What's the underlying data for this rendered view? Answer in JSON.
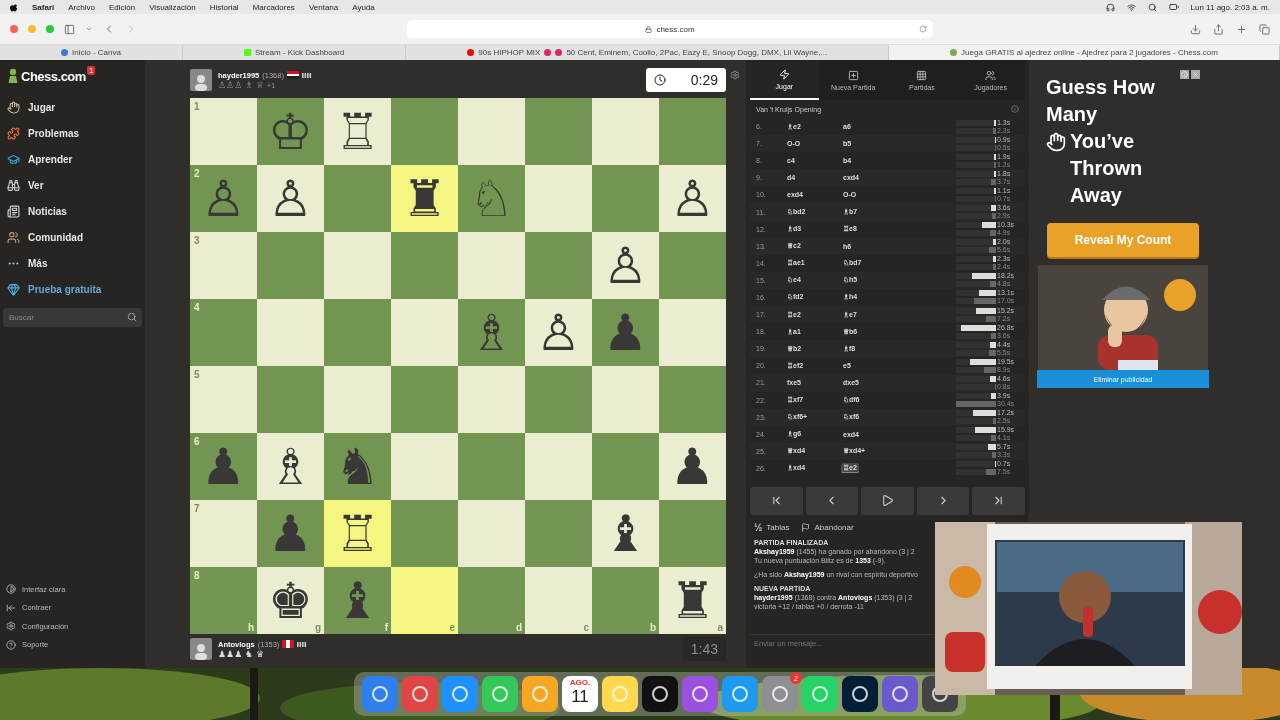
{
  "menubar": {
    "app": "Safari",
    "menus": [
      "Archivo",
      "Edición",
      "Visualización",
      "Historial",
      "Marcadores",
      "Ventana",
      "Ayuda"
    ],
    "clock": "Lun 11 ago.  2:03 a. m."
  },
  "browser": {
    "address": "chess.com",
    "tabs": [
      {
        "title": "Inicio - Canva",
        "selected": false
      },
      {
        "title": "Stream - Kick Dashboard",
        "selected": false
      },
      {
        "title": "90s HIPHOP MIX",
        "title_rest": "50 Cent, Eminem, Coolio, 2Pac, Eazy E, Snoop Dogg, DMX, Lil Wayne,...",
        "selected": false
      },
      {
        "title": "Juega GRATIS al ajedrez online - Ajedrez para 2 jugadores - Chess.com",
        "selected": true
      }
    ]
  },
  "sidebar": {
    "logo": "Chess.com",
    "notification": "1",
    "items": [
      {
        "label": "Jugar",
        "kind": "normal"
      },
      {
        "label": "Problemas",
        "kind": "normal"
      },
      {
        "label": "Aprender",
        "kind": "normal"
      },
      {
        "label": "Ver",
        "kind": "normal"
      },
      {
        "label": "Noticias",
        "kind": "normal"
      },
      {
        "label": "Comunidad",
        "kind": "normal"
      },
      {
        "label": "Más",
        "kind": "normal"
      },
      {
        "label": "Prueba gratuita",
        "kind": "promo"
      }
    ],
    "search": {
      "placeholder": "Buscar"
    },
    "footer": [
      "Interfaz clara",
      "Contraer",
      "Configuración",
      "Soporte"
    ]
  },
  "top_player": {
    "name": "hayder1995",
    "rating": "(1368)",
    "captured": "♙♙♙ ♗ ♕",
    "advantage": "+1",
    "clock": {
      "time": "0:29",
      "active": true
    }
  },
  "bottom_player": {
    "name": "Antovlogs",
    "rating": "(1353)",
    "captured": "♟♟♟ ♞ ♛",
    "clock": {
      "time": "1:43",
      "active": false
    }
  },
  "board": {
    "files": [
      "h",
      "g",
      "f",
      "e",
      "d",
      "c",
      "b",
      "a"
    ],
    "ranks": [
      {
        "label": "1",
        "squares": [
          {
            "highlighted": false
          },
          {
            "piece": "♔",
            "highlighted": false
          },
          {
            "piece": "♖",
            "highlighted": false
          },
          {
            "highlighted": false
          },
          {
            "highlighted": false
          },
          {
            "highlighted": false
          },
          {
            "highlighted": false
          },
          {
            "highlighted": false
          }
        ]
      },
      {
        "label": "2",
        "squares": [
          {
            "piece": "♙",
            "highlighted": false
          },
          {
            "piece": "♙",
            "highlighted": false
          },
          {
            "highlighted": false
          },
          {
            "piece": "♜",
            "highlighted": true
          },
          {
            "piece": "♘",
            "highlighted": false
          },
          {
            "highlighted": false
          },
          {
            "highlighted": false
          },
          {
            "piece": "♙",
            "highlighted": false
          }
        ]
      },
      {
        "label": "3",
        "squares": [
          {
            "highlighted": false
          },
          {
            "highlighted": false
          },
          {
            "highlighted": false
          },
          {
            "highlighted": false
          },
          {
            "highlighted": false
          },
          {
            "highlighted": false
          },
          {
            "piece": "♙",
            "highlighted": false
          },
          {
            "highlighted": false
          }
        ]
      },
      {
        "label": "4",
        "squares": [
          {
            "highlighted": false
          },
          {
            "highlighted": false
          },
          {
            "highlighted": false
          },
          {
            "highlighted": false
          },
          {
            "piece": "♗",
            "highlighted": false
          },
          {
            "piece": "♙",
            "highlighted": false
          },
          {
            "piece": "♟",
            "highlighted": false
          },
          {
            "highlighted": false
          }
        ]
      },
      {
        "label": "5",
        "squares": [
          {
            "highlighted": false
          },
          {
            "highlighted": false
          },
          {
            "highlighted": false
          },
          {
            "highlighted": false
          },
          {
            "highlighted": false
          },
          {
            "highlighted": false
          },
          {
            "highlighted": false
          },
          {
            "highlighted": false
          }
        ]
      },
      {
        "label": "6",
        "squares": [
          {
            "piece": "♟",
            "highlighted": false
          },
          {
            "piece": "♗",
            "highlighted": false
          },
          {
            "piece": "♞",
            "highlighted": false
          },
          {
            "highlighted": false
          },
          {
            "highlighted": false
          },
          {
            "highlighted": false
          },
          {
            "highlighted": false
          },
          {
            "piece": "♟",
            "highlighted": false
          }
        ]
      },
      {
        "label": "7",
        "squares": [
          {
            "highlighted": false
          },
          {
            "piece": "♟",
            "highlighted": false
          },
          {
            "piece": "♖",
            "highlighted": true
          },
          {
            "highlighted": false
          },
          {
            "highlighted": false
          },
          {
            "highlighted": false
          },
          {
            "piece": "♝",
            "highlighted": false
          },
          {
            "highlighted": false
          }
        ]
      },
      {
        "label": "8",
        "squares": [
          {
            "highlighted": false
          },
          {
            "piece": "♚",
            "highlighted": false
          },
          {
            "piece": "♝",
            "highlighted": false
          },
          {
            "highlighted": true
          },
          {
            "highlighted": false
          },
          {
            "highlighted": false
          },
          {
            "highlighted": false
          },
          {
            "piece": "♜",
            "highlighted": false
          }
        ]
      }
    ]
  },
  "panel": {
    "tabs": [
      {
        "label": "Jugar",
        "selected": true
      },
      {
        "label": "Nueva Partida",
        "selected": false
      },
      {
        "label": "Partidas",
        "selected": false
      },
      {
        "label": "Jugadores",
        "selected": false
      }
    ],
    "opening": "Van 't Kruijs Opening",
    "moves": [
      {
        "number": "6.",
        "white": {
          "piece": "♗",
          "san": "e2",
          "selected": false
        },
        "black": {
          "san": "a6",
          "selected": false
        },
        "times": [
          {
            "text": "1.3s",
            "level": 0.04
          },
          {
            "text": "2.3s",
            "level": 0.08
          }
        ]
      },
      {
        "number": "7.",
        "white": {
          "san": "O-O",
          "selected": false
        },
        "black": {
          "san": "b5",
          "selected": false
        },
        "times": [
          {
            "text": "0.9s",
            "level": 0.03
          },
          {
            "text": "0.5s",
            "level": 0.02
          }
        ]
      },
      {
        "number": "8.",
        "white": {
          "san": "c4",
          "selected": false
        },
        "black": {
          "san": "b4",
          "selected": false
        },
        "times": [
          {
            "text": "1.9s",
            "level": 0.06
          },
          {
            "text": "1.2s",
            "level": 0.04
          }
        ]
      },
      {
        "number": "9.",
        "white": {
          "san": "d4",
          "selected": false
        },
        "black": {
          "san": "cxd4",
          "selected": false
        },
        "times": [
          {
            "text": "1.8s",
            "level": 0.06
          },
          {
            "text": "3.7s",
            "level": 0.12
          }
        ]
      },
      {
        "number": "10.",
        "white": {
          "san": "exd4",
          "selected": false
        },
        "black": {
          "san": "O-O",
          "selected": false
        },
        "times": [
          {
            "text": "1.1s",
            "level": 0.04
          },
          {
            "text": "0.7s",
            "level": 0.02
          }
        ]
      },
      {
        "number": "11.",
        "white": {
          "piece": "♘",
          "san": "bd2",
          "selected": false
        },
        "black": {
          "piece": "♗",
          "san": "b7",
          "selected": false
        },
        "times": [
          {
            "text": "3.6s",
            "level": 0.12
          },
          {
            "text": "2.9s",
            "level": 0.1
          }
        ]
      },
      {
        "number": "12.",
        "white": {
          "piece": "♗",
          "san": "d3",
          "selected": false
        },
        "black": {
          "piece": "♖",
          "san": "e8",
          "selected": false
        },
        "times": [
          {
            "text": "10.3s",
            "level": 0.34
          },
          {
            "text": "4.9s",
            "level": 0.16
          }
        ]
      },
      {
        "number": "13.",
        "white": {
          "piece": "♕",
          "san": "c2",
          "selected": false
        },
        "black": {
          "san": "h6",
          "selected": false
        },
        "times": [
          {
            "text": "2.0s",
            "level": 0.07
          },
          {
            "text": "5.6s",
            "level": 0.18
          }
        ]
      },
      {
        "number": "14.",
        "white": {
          "piece": "♖",
          "san": "ae1",
          "selected": false
        },
        "black": {
          "piece": "♘",
          "san": "bd7",
          "selected": false
        },
        "times": [
          {
            "text": "2.3s",
            "level": 0.08
          },
          {
            "text": "2.4s",
            "level": 0.08
          }
        ]
      },
      {
        "number": "15.",
        "white": {
          "piece": "♘",
          "san": "e4",
          "selected": false
        },
        "black": {
          "piece": "♘",
          "san": "h5",
          "selected": false
        },
        "times": [
          {
            "text": "18.2s",
            "level": 0.6
          },
          {
            "text": "4.8s",
            "level": 0.16
          }
        ]
      },
      {
        "number": "16.",
        "white": {
          "piece": "♘",
          "san": "fd2",
          "selected": false
        },
        "black": {
          "piece": "♗",
          "san": "h4",
          "selected": false
        },
        "times": [
          {
            "text": "13.1s",
            "level": 0.43
          },
          {
            "text": "17.0s",
            "level": 0.56
          }
        ]
      },
      {
        "number": "17.",
        "white": {
          "piece": "♖",
          "san": "e2",
          "selected": false
        },
        "black": {
          "piece": "♗",
          "san": "e7",
          "selected": false
        },
        "times": [
          {
            "text": "15.2s",
            "level": 0.5
          },
          {
            "text": "7.2s",
            "level": 0.24
          }
        ]
      },
      {
        "number": "18.",
        "white": {
          "piece": "♗",
          "san": "a1",
          "selected": false
        },
        "black": {
          "piece": "♕",
          "san": "b6",
          "selected": false
        },
        "times": [
          {
            "text": "26.8s",
            "level": 0.88
          },
          {
            "text": "3.6s",
            "level": 0.12
          }
        ]
      },
      {
        "number": "19.",
        "white": {
          "piece": "♕",
          "san": "b2",
          "selected": false
        },
        "black": {
          "piece": "♗",
          "san": "f8",
          "selected": false
        },
        "times": [
          {
            "text": "4.4s",
            "level": 0.14
          },
          {
            "text": "5.5s",
            "level": 0.18
          }
        ]
      },
      {
        "number": "20.",
        "white": {
          "piece": "♖",
          "san": "ef2",
          "selected": false
        },
        "black": {
          "san": "e5",
          "selected": false
        },
        "times": [
          {
            "text": "19.5s",
            "level": 0.64
          },
          {
            "text": "8.9s",
            "level": 0.29
          }
        ]
      },
      {
        "number": "21.",
        "white": {
          "san": "fxe5",
          "selected": false
        },
        "black": {
          "san": "dxe5",
          "selected": false
        },
        "times": [
          {
            "text": "4.6s",
            "level": 0.15
          },
          {
            "text": "0.8s",
            "level": 0.03
          }
        ]
      },
      {
        "number": "22.",
        "white": {
          "piece": "♖",
          "san": "xf7",
          "selected": false
        },
        "black": {
          "piece": "♘",
          "san": "df6",
          "selected": false
        },
        "times": [
          {
            "text": "3.9s",
            "level": 0.13
          },
          {
            "text": "30.4s",
            "level": 1
          }
        ]
      },
      {
        "number": "23.",
        "white": {
          "piece": "♘",
          "san": "xf6+",
          "selected": false
        },
        "black": {
          "piece": "♘",
          "san": "xf6",
          "selected": false
        },
        "times": [
          {
            "text": "17.2s",
            "level": 0.57
          },
          {
            "text": "2.5s",
            "level": 0.08
          }
        ]
      },
      {
        "number": "24.",
        "white": {
          "piece": "♗",
          "san": "g6",
          "selected": false
        },
        "black": {
          "san": "exd4",
          "selected": false
        },
        "times": [
          {
            "text": "15.9s",
            "level": 0.52
          },
          {
            "text": "4.1s",
            "level": 0.13
          }
        ]
      },
      {
        "number": "25.",
        "white": {
          "piece": "♕",
          "san": "xd4",
          "selected": false
        },
        "black": {
          "piece": "♕",
          "san": "xd4+",
          "selected": false
        },
        "times": [
          {
            "text": "5.7s",
            "level": 0.19
          },
          {
            "text": "3.3s",
            "level": 0.11
          }
        ]
      },
      {
        "number": "26.",
        "white": {
          "piece": "♗",
          "san": "xd4",
          "selected": false
        },
        "black": {
          "piece": "♖",
          "san": "e2",
          "selected": true
        },
        "times": [
          {
            "text": "0.7s",
            "level": 0.02
          },
          {
            "text": "7.5s",
            "level": 0.25
          }
        ]
      }
    ],
    "draw": {
      "symbol": "½",
      "label": "Tablas"
    },
    "resign": "Abandonar",
    "chat": [
      {
        "kind": "heading",
        "text": "PARTIDA FINALIZADA"
      },
      {
        "kind": "line",
        "text": "**Akshay1959** (1455) ha ganado por abandono (3 | 2"
      },
      {
        "kind": "line",
        "text": "Tu nueva puntuación Blitz es de **1353** (-9)."
      },
      {
        "kind": "spaced",
        "text": "¿Ha sido **Akshay1959** un rival con espíritu deportivo"
      },
      {
        "kind": "section",
        "text": "NUEVA PARTIDA"
      },
      {
        "kind": "line",
        "text": "**hayder1995** (1368) contra **Antovlogs** (1353) (3 | 2"
      },
      {
        "kind": "line",
        "text": "victoria +12 / tablas +0 / derrota -11"
      }
    ],
    "message": {
      "placeholder": "Enviar un mensaje..."
    }
  },
  "ad": {
    "headline_top": "Guess How Many",
    "headline_bottom": "You’ve Thrown Away",
    "button": "Reveal My Count",
    "remove": "Eliminar publicidad"
  },
  "dock": {
    "calendar_month": "AGO.",
    "calendar_day": "11",
    "settings_badge": "2"
  }
}
